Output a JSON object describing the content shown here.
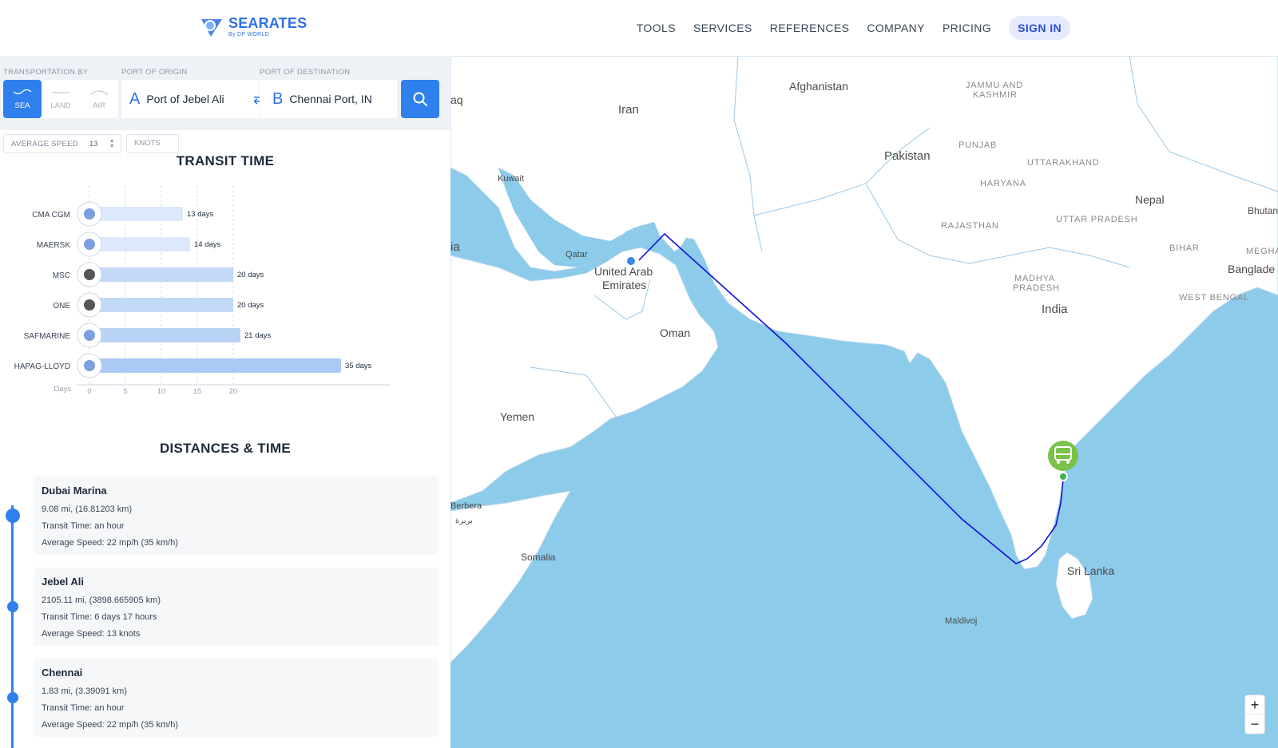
{
  "header": {
    "brand_name": "SEARATES",
    "brand_sub": "By DP WORLD",
    "nav": [
      "TOOLS",
      "SERVICES",
      "REFERENCES",
      "COMPANY",
      "PRICING"
    ],
    "sign_in": "SIGN IN",
    "accent": "#2f80ed"
  },
  "search": {
    "transport_label": "TRANSPORTATION BY",
    "origin_label": "PORT OF ORIGIN",
    "destination_label": "PORT OF DESTINATION",
    "modes": [
      "SEA",
      "LAND",
      "AIR"
    ],
    "active_mode": "SEA",
    "origin_letter": "A",
    "origin": "Port of Jebel Ali",
    "destination_letter": "B",
    "destination": "Chennai Port, IN",
    "swap_icon": "⇄",
    "speed_label": "AVERAGE SPEED",
    "speed_value": "13",
    "speed_unit": "KNOTS"
  },
  "transit": {
    "title": "TRANSIT TIME",
    "axis_label": "Days",
    "ticks": [
      "0",
      "5",
      "10",
      "15",
      "20"
    ]
  },
  "chart_data": {
    "type": "bar",
    "orientation": "horizontal",
    "title": "TRANSIT TIME",
    "xlabel": "Days",
    "categories": [
      "CMA CGM",
      "MAERSK",
      "MSC",
      "ONE",
      "SAFMARINE",
      "HAPAG-LLOYD"
    ],
    "values": [
      13,
      14,
      20,
      20,
      21,
      35
    ],
    "data_labels": [
      "13 days",
      "14 days",
      "20 days",
      "20 days",
      "21 days",
      "35 days"
    ],
    "xlim": [
      0,
      20
    ],
    "grid": true,
    "colors": [
      "#dce9fb",
      "#dce9fb",
      "#c2d9f8",
      "#c2d9f8",
      "#b9d3f7",
      "#acc9f5"
    ]
  },
  "distances": {
    "title": "DISTANCES & TIME",
    "legs": [
      {
        "name": "Dubai Marina",
        "distance": "9.08 mi, (16.81203 km)",
        "transit": "Transit Time: an hour",
        "speed": "Average Speed: 22 mp/h (35 km/h)"
      },
      {
        "name": "Jebel Ali",
        "distance": "2105.11 mi, (3898.665905 km)",
        "transit": "Transit Time: 6 days 17 hours",
        "speed": "Average Speed: 13 knots"
      },
      {
        "name": "Chennai",
        "distance": "1.83 mi, (3.39091 km)",
        "transit": "Transit Time: an hour",
        "speed": "Average Speed: 22 mp/h (35 km/h)"
      }
    ]
  },
  "map": {
    "labels": {
      "iran": "Iran",
      "afghanistan": "Afghanistan",
      "pakistan": "Pakistan",
      "india": "India",
      "nepal": "Nepal",
      "bhutan": "Bhutan",
      "bangladesh": "Banglade",
      "sri_lanka": "Sri Lanka",
      "oman": "Oman",
      "yemen": "Yemen",
      "somalia": "Somalia",
      "uae_1": "United Arab",
      "uae_2": "Emirates",
      "qatar": "Qatar",
      "kuwait": "Kuwait",
      "iraq": "aq",
      "arabia": "ia",
      "berbera": "Berbera",
      "berbera_ar": "بربرة",
      "maldives": "Maldivoj",
      "jammu": "JAMMU AND",
      "kashmir": "KASHMIR",
      "punjab": "PUNJAB",
      "uttarakhand": "UTTARAKHAND",
      "haryana": "HARYANA",
      "rajasthan": "RAJASTHAN",
      "uttar_pradesh": "UTTAR PRADESH",
      "bihar": "BIHAR",
      "megha": "MEGHA",
      "madhya_1": "MADHYA",
      "madhya_2": "PRADESH",
      "west_bengal": "WEST BENGAL"
    },
    "zoom_in": "+",
    "zoom_out": "−",
    "sea_color": "#8ccbea",
    "land_color": "#ffffff",
    "route_color": "#1010d8"
  }
}
